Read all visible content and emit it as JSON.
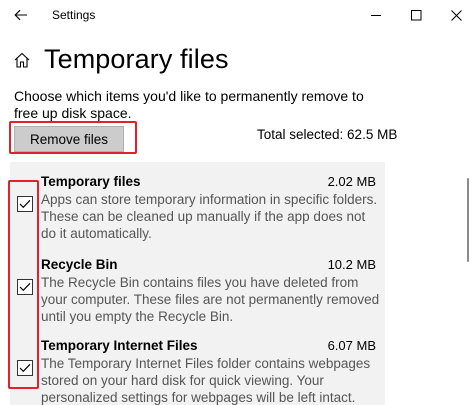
{
  "window": {
    "title": "Settings"
  },
  "header": {
    "title": "Temporary files"
  },
  "description": "Choose which items you'd like to permanently remove to free up disk space.",
  "remove_button": {
    "label": "Remove files"
  },
  "total_selected": "Total selected: 62.5 MB",
  "items": [
    {
      "name": "Temporary files",
      "size": "2.02 MB",
      "checked": true,
      "description": "Apps can store temporary information in specific folders. These can be cleaned up manually if the app does not do it automatically."
    },
    {
      "name": "Recycle Bin",
      "size": "10.2 MB",
      "checked": true,
      "description": "The Recycle Bin contains files you have deleted from your computer. These files are not permanently removed until you empty the Recycle Bin."
    },
    {
      "name": "Temporary Internet Files",
      "size": "6.07 MB",
      "checked": true,
      "description": "The Temporary Internet Files folder contains webpages stored on your hard disk for quick viewing. Your personalized settings for webpages will be left intact."
    }
  ],
  "icons": {
    "back": "back-arrow-icon",
    "home": "home-icon",
    "minimize": "minimize-icon",
    "maximize": "maximize-icon",
    "close": "close-icon",
    "check": "checkmark-icon"
  },
  "colors": {
    "highlight": "#e3202b",
    "list_background": "#f2f2f2",
    "button_background": "#cccccc"
  }
}
